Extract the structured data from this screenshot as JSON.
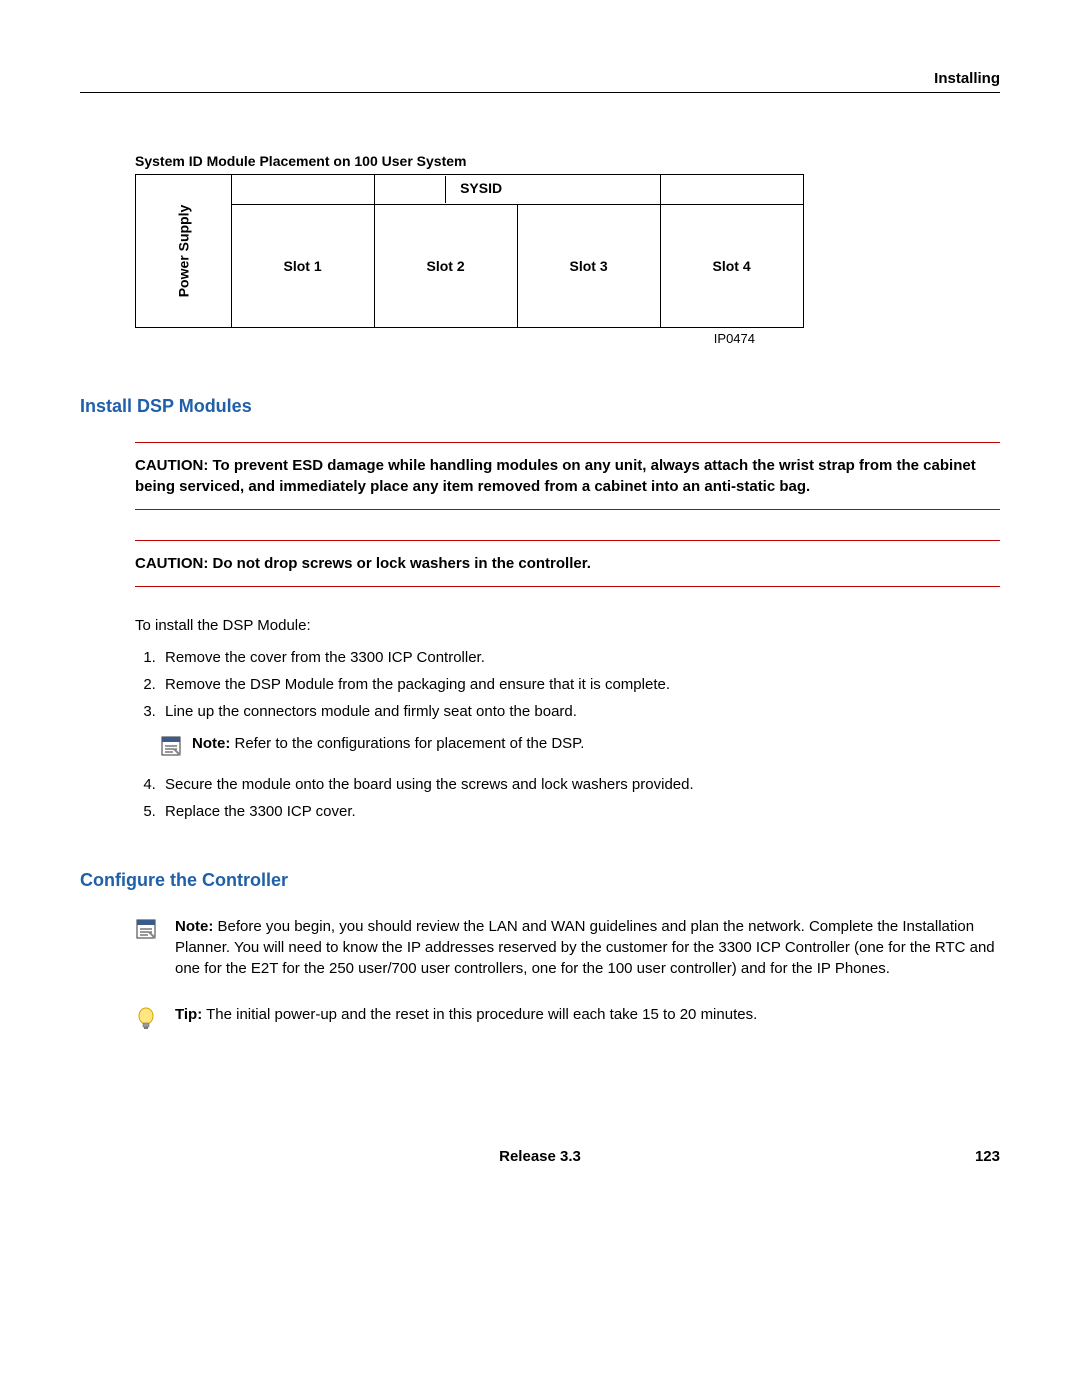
{
  "header": {
    "section_name": "Installing"
  },
  "figure": {
    "caption": "System ID Module Placement on 100 User System",
    "power_label": "Power Supply",
    "sysid_label": "SYSID",
    "slots": [
      "Slot 1",
      "Slot 2",
      "Slot 3",
      "Slot 4"
    ],
    "figure_id": "IP0474"
  },
  "section1": {
    "title": "Install DSP Modules",
    "caution1": "CAUTION: To prevent ESD damage while handling modules on any unit, always attach the wrist strap from the cabinet being serviced, and immediately place any item removed from a cabinet into an anti-static bag.",
    "caution2": "CAUTION: Do not drop screws or lock washers in the controller.",
    "intro": "To install the DSP Module:",
    "steps": [
      "Remove the cover from the 3300 ICP Controller.",
      "Remove the DSP Module from the packaging and ensure that it is complete.",
      "Line up the connectors module and firmly seat onto the board."
    ],
    "note_label": "Note:",
    "note_text": " Refer to the configurations for placement of the DSP.",
    "steps_after": [
      "Secure the module onto the board using the screws and lock washers provided.",
      "Replace the 3300 ICP cover."
    ]
  },
  "section2": {
    "title": "Configure the Controller",
    "note_label": "Note:",
    "note_text": " Before you begin, you should review the LAN and WAN guidelines and plan the network. Complete the Installation Planner. You will need to know the IP addresses reserved by the customer for the 3300 ICP Controller (one for the RTC and one for the E2T for the 250 user/700 user controllers, one for the 100 user controller) and for the IP Phones.",
    "tip_label": "Tip:",
    "tip_text": " The initial power-up and the reset in this procedure will each take 15 to 20 minutes."
  },
  "footer": {
    "release": "Release 3.3",
    "page": "123"
  }
}
